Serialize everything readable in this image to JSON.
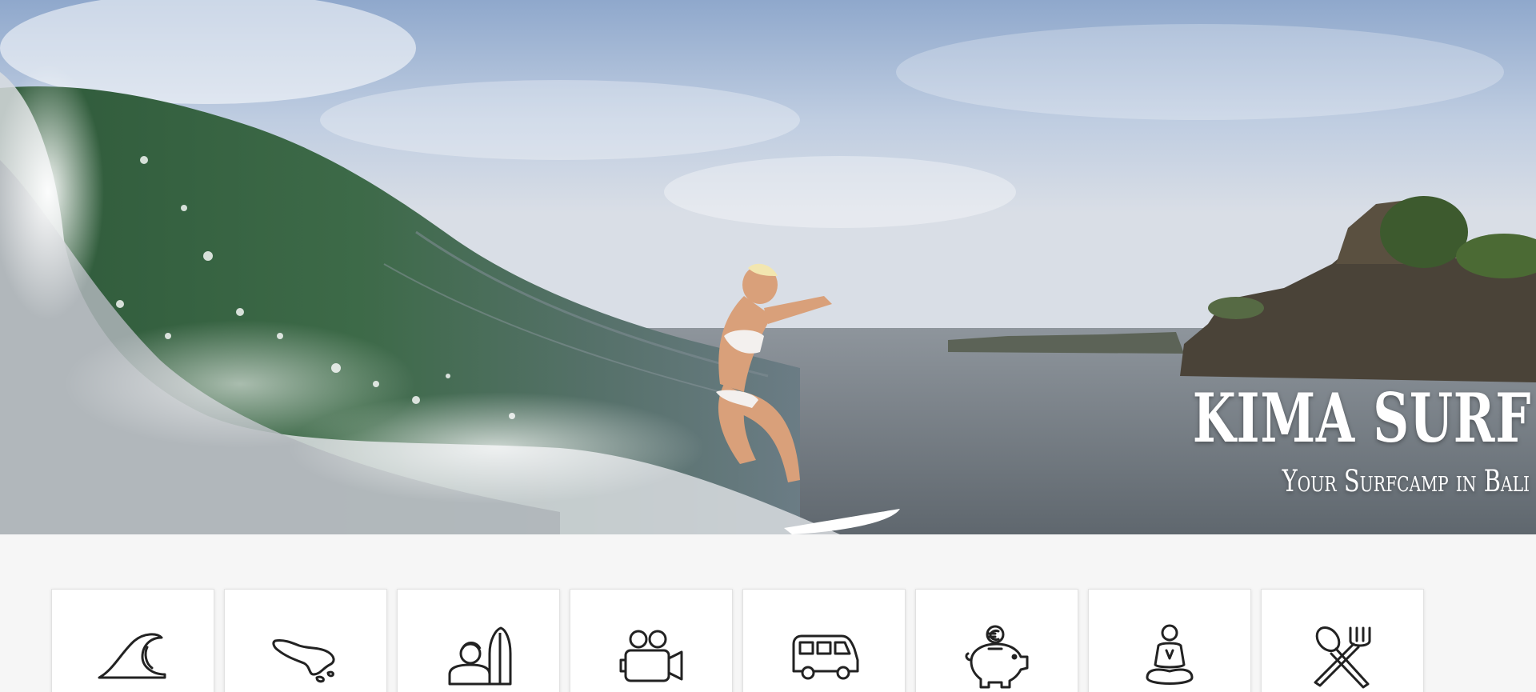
{
  "hero": {
    "title": "KIMA SURF",
    "tagline": "Your Surfcamp in Bali",
    "image_alt": "surfer riding a wave"
  },
  "services": [
    {
      "name": "surf-lessons",
      "icon": "wave-icon"
    },
    {
      "name": "bali-island",
      "icon": "bali-map-icon"
    },
    {
      "name": "surf-coaching",
      "icon": "surfer-with-board-icon"
    },
    {
      "name": "video-analysis",
      "icon": "video-camera-icon"
    },
    {
      "name": "transport",
      "icon": "van-icon"
    },
    {
      "name": "prices",
      "icon": "piggy-bank-euro-icon"
    },
    {
      "name": "yoga",
      "icon": "yoga-meditation-icon"
    },
    {
      "name": "food",
      "icon": "spoon-fork-icon"
    }
  ],
  "colors": {
    "icon_stroke": "#222222",
    "tile_background": "#ffffff",
    "page_background": "#f6f6f6"
  }
}
